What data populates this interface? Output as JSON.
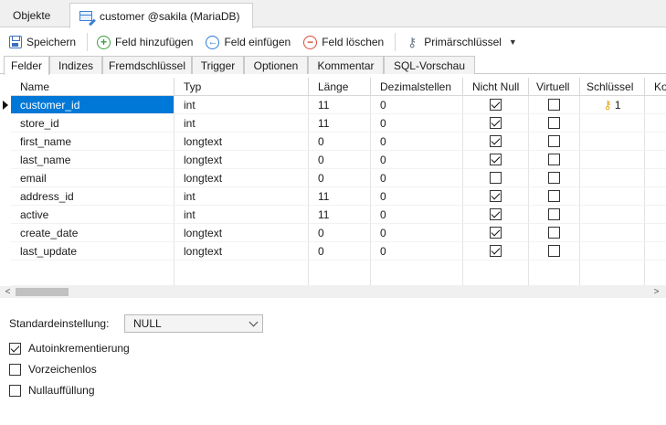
{
  "doc_tabs": {
    "objects": "Objekte",
    "active": "customer @sakila (MariaDB)"
  },
  "toolbar": {
    "save": "Speichern",
    "add_field": "Feld hinzufügen",
    "insert_field": "Feld einfügen",
    "delete_field": "Feld löschen",
    "primary_key": "Primärschlüssel"
  },
  "subtabs": [
    "Felder",
    "Indizes",
    "Fremdschlüssel",
    "Trigger",
    "Optionen",
    "Kommentar",
    "SQL-Vorschau"
  ],
  "columns": [
    "Name",
    "Typ",
    "Länge",
    "Dezimalstellen",
    "Nicht Null",
    "Virtuell",
    "Schlüssel",
    "Ko"
  ],
  "rows": [
    {
      "name": "customer_id",
      "type": "int",
      "length": "11",
      "decimals": "0",
      "not_null": true,
      "virtual": false,
      "key": "1"
    },
    {
      "name": "store_id",
      "type": "int",
      "length": "11",
      "decimals": "0",
      "not_null": true,
      "virtual": false,
      "key": ""
    },
    {
      "name": "first_name",
      "type": "longtext",
      "length": "0",
      "decimals": "0",
      "not_null": true,
      "virtual": false,
      "key": ""
    },
    {
      "name": "last_name",
      "type": "longtext",
      "length": "0",
      "decimals": "0",
      "not_null": true,
      "virtual": false,
      "key": ""
    },
    {
      "name": "email",
      "type": "longtext",
      "length": "0",
      "decimals": "0",
      "not_null": false,
      "virtual": false,
      "key": ""
    },
    {
      "name": "address_id",
      "type": "int",
      "length": "11",
      "decimals": "0",
      "not_null": true,
      "virtual": false,
      "key": ""
    },
    {
      "name": "active",
      "type": "int",
      "length": "11",
      "decimals": "0",
      "not_null": true,
      "virtual": false,
      "key": ""
    },
    {
      "name": "create_date",
      "type": "longtext",
      "length": "0",
      "decimals": "0",
      "not_null": true,
      "virtual": false,
      "key": ""
    },
    {
      "name": "last_update",
      "type": "longtext",
      "length": "0",
      "decimals": "0",
      "not_null": true,
      "virtual": false,
      "key": ""
    }
  ],
  "selected_row": 0,
  "props": {
    "default_label": "Standardeinstellung:",
    "default_value": "NULL",
    "auto_increment": {
      "label": "Autoinkrementierung",
      "checked": true
    },
    "unsigned": {
      "label": "Vorzeichenlos",
      "checked": false
    },
    "zerofill": {
      "label": "Nullauffüllung",
      "checked": false
    }
  },
  "colors": {
    "selection": "#0078d7",
    "key_icon": "#e8a317"
  }
}
